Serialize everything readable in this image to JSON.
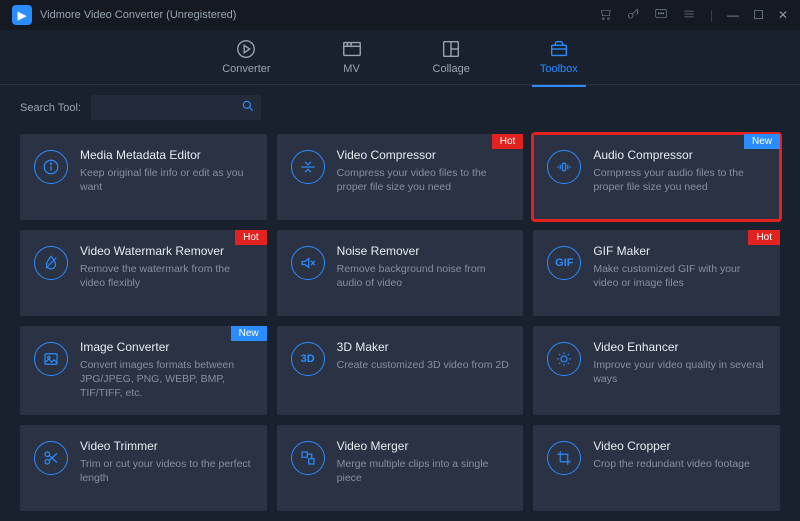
{
  "titlebar": {
    "title": "Vidmore Video Converter (Unregistered)"
  },
  "nav": {
    "items": [
      {
        "label": "Converter"
      },
      {
        "label": "MV"
      },
      {
        "label": "Collage"
      },
      {
        "label": "Toolbox"
      }
    ]
  },
  "search": {
    "label": "Search Tool:",
    "value": ""
  },
  "tools": [
    {
      "title": "Media Metadata Editor",
      "desc": "Keep original file info or edit as you want",
      "badge": null,
      "icon": "info"
    },
    {
      "title": "Video Compressor",
      "desc": "Compress your video files to the proper file size you need",
      "badge": "Hot",
      "icon": "compress"
    },
    {
      "title": "Audio Compressor",
      "desc": "Compress your audio files to the proper file size you need",
      "badge": "New",
      "icon": "audio-compress",
      "highlight": true
    },
    {
      "title": "Video Watermark Remover",
      "desc": "Remove the watermark from the video flexibly",
      "badge": "Hot",
      "icon": "watermark"
    },
    {
      "title": "Noise Remover",
      "desc": "Remove background noise from audio of video",
      "badge": null,
      "icon": "noise"
    },
    {
      "title": "GIF Maker",
      "desc": "Make customized GIF with your video or image files",
      "badge": "Hot",
      "icon": "gif"
    },
    {
      "title": "Image Converter",
      "desc": "Convert images formats between JPG/JPEG, PNG, WEBP, BMP, TIF/TIFF, etc.",
      "badge": "New",
      "icon": "image"
    },
    {
      "title": "3D Maker",
      "desc": "Create customized 3D video from 2D",
      "badge": null,
      "icon": "3d"
    },
    {
      "title": "Video Enhancer",
      "desc": "Improve your video quality in several ways",
      "badge": null,
      "icon": "enhance"
    },
    {
      "title": "Video Trimmer",
      "desc": "Trim or cut your videos to the perfect length",
      "badge": null,
      "icon": "trim"
    },
    {
      "title": "Video Merger",
      "desc": "Merge multiple clips into a single piece",
      "badge": null,
      "icon": "merge"
    },
    {
      "title": "Video Cropper",
      "desc": "Crop the redundant video footage",
      "badge": null,
      "icon": "crop"
    }
  ],
  "badges": {
    "Hot": "Hot",
    "New": "New"
  }
}
